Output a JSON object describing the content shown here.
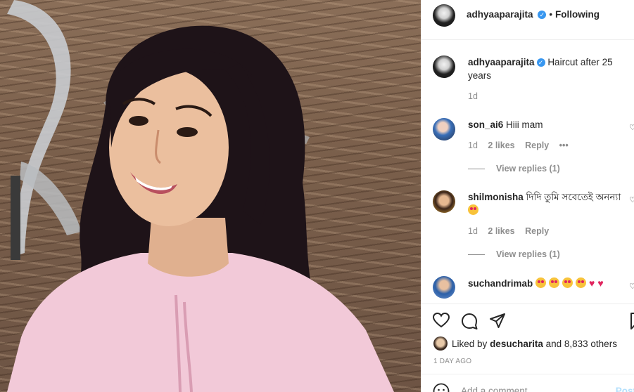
{
  "header": {
    "username": "adhyaaparajita",
    "separator": "•",
    "follow_status": "Following"
  },
  "caption": {
    "username": "adhyaaparajita",
    "text": "Haircut after 25 years",
    "time": "1d"
  },
  "comments": [
    {
      "username": "son_ai6",
      "text": "Hiii mam",
      "time": "1d",
      "likes": "2 likes",
      "reply_label": "Reply",
      "more_label": "•••",
      "view_replies": "View replies (1)"
    },
    {
      "username": "shilmonisha",
      "text": "দিদি তুমি সবেতেই অনন্যা",
      "time": "1d",
      "likes": "2 likes",
      "reply_label": "Reply",
      "view_replies": "View replies (1)"
    },
    {
      "username": "suchandrimab",
      "text": ""
    }
  ],
  "actions": {
    "icons": [
      "heart-icon",
      "comment-icon",
      "share-icon",
      "bookmark-icon"
    ],
    "liked_by_prefix": "Liked by",
    "liked_by_user": "desucharita",
    "liked_by_suffix": "and 8,833 others",
    "time_ago": "1 DAY AGO"
  },
  "add_comment": {
    "placeholder": "Add a comment...",
    "post_label": "Post"
  },
  "colors": {
    "verified": "#3897f0",
    "muted": "#8e8e8e",
    "text": "#262626",
    "post_disabled": "#b2dffc"
  }
}
